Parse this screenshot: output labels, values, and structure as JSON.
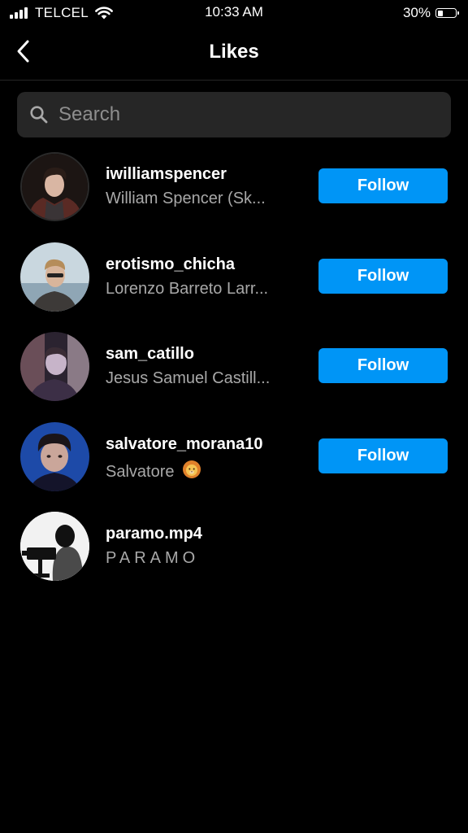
{
  "status_bar": {
    "carrier": "TELCEL",
    "time": "10:33 AM",
    "battery_percent": "30%",
    "battery_level": 0.3,
    "signal_bars": 4
  },
  "header": {
    "title": "Likes",
    "back_icon": "chevron-left-icon"
  },
  "search": {
    "placeholder": "Search",
    "value": "",
    "icon": "search-icon"
  },
  "likes": [
    {
      "username": "iwilliamspencer",
      "full_name": "William Spencer (Sk...",
      "follow_label": "Follow"
    },
    {
      "username": "erotismo_chicha",
      "full_name": "Lorenzo Barreto Larr...",
      "follow_label": "Follow"
    },
    {
      "username": "sam_catillo",
      "full_name": "Jesus Samuel Castill...",
      "follow_label": "Follow"
    },
    {
      "username": "salvatore_morana10",
      "full_name": "Salvatore",
      "full_name_emoji": "lion-face-emoji",
      "follow_label": "Follow"
    },
    {
      "username": "paramo.mp4",
      "full_name": "PARAMO"
    }
  ],
  "colors": {
    "background": "#000000",
    "follow_button": "#0095f6",
    "secondary_text": "#a8a8a8",
    "search_bg": "#262626"
  }
}
